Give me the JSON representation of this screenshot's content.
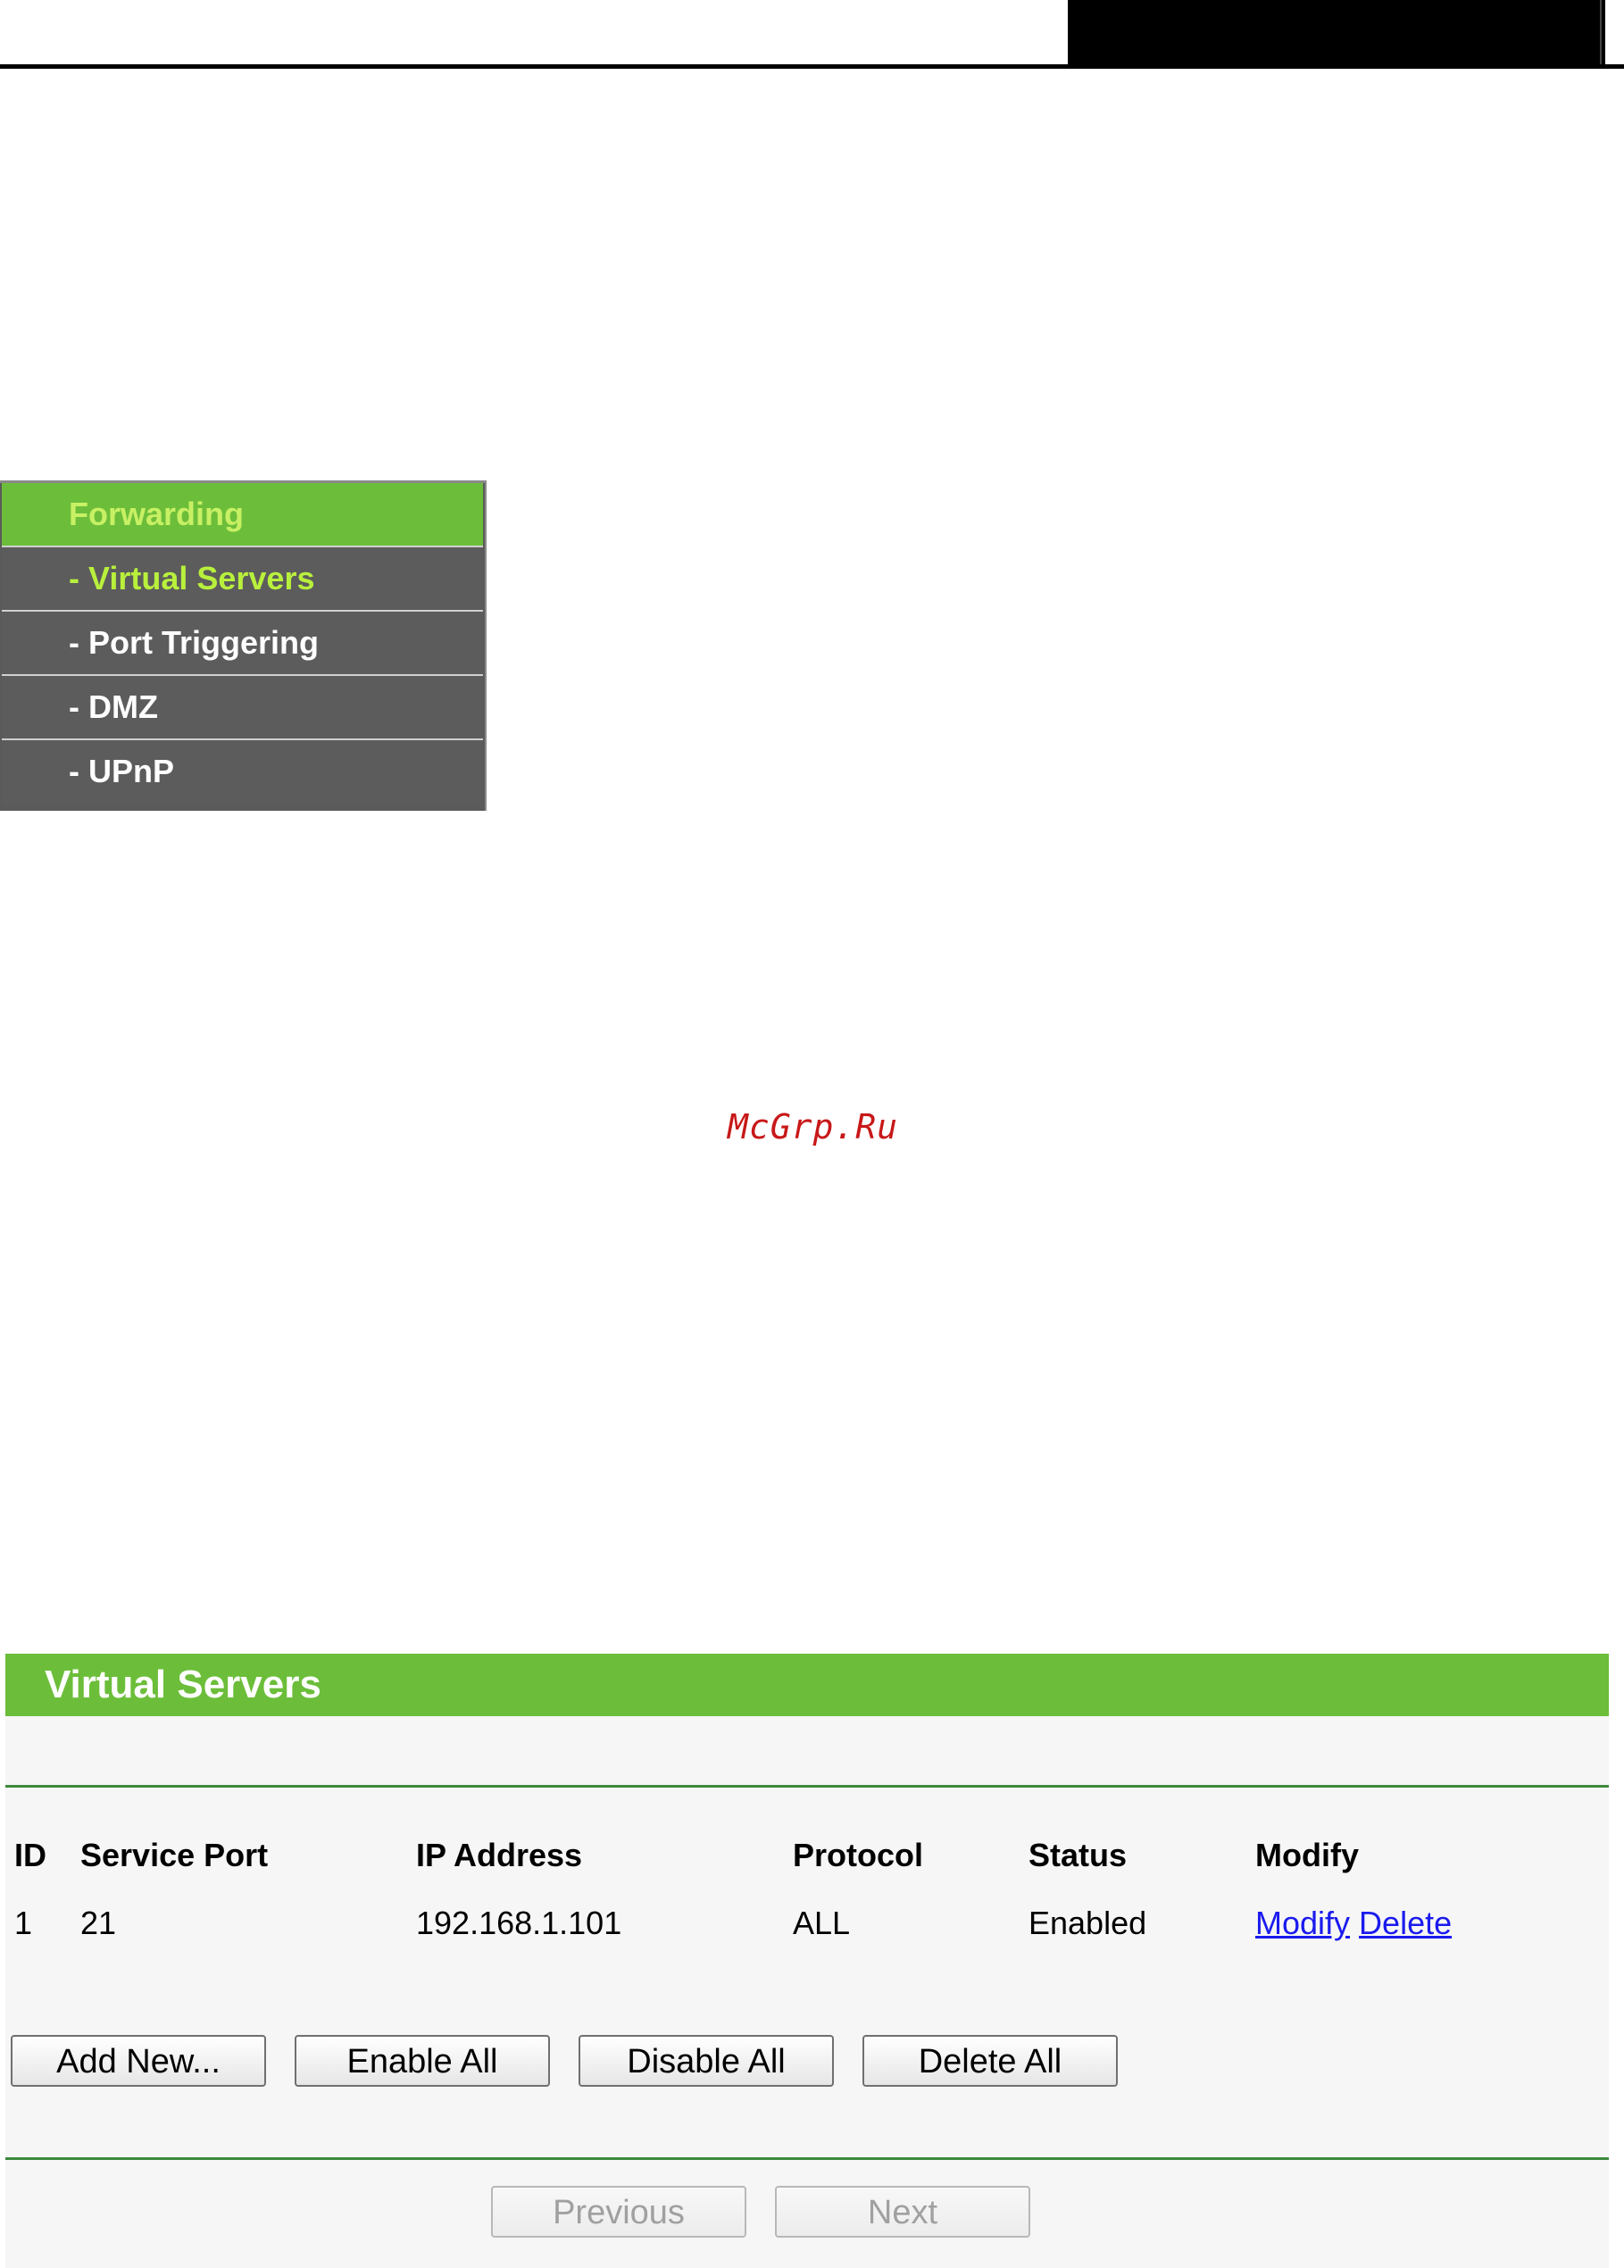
{
  "menu": {
    "header": "Forwarding",
    "items": [
      {
        "label": "- Virtual Servers",
        "active": true
      },
      {
        "label": "- Port Triggering",
        "active": false
      },
      {
        "label": "- DMZ",
        "active": false
      },
      {
        "label": "- UPnP",
        "active": false
      }
    ]
  },
  "watermark": "McGrp.Ru",
  "virtual_servers": {
    "title": "Virtual Servers",
    "columns": {
      "id": "ID",
      "service_port": "Service Port",
      "ip_address": "IP Address",
      "protocol": "Protocol",
      "status": "Status",
      "modify": "Modify"
    },
    "rows": [
      {
        "id": "1",
        "service_port": "21",
        "ip_address": "192.168.1.101",
        "protocol": "ALL",
        "status": "Enabled",
        "modify_label": "Modify",
        "delete_label": "Delete"
      }
    ],
    "buttons": {
      "add_new": "Add New...",
      "enable_all": "Enable All",
      "disable_all": "Disable All",
      "delete_all": "Delete All"
    },
    "pagination": {
      "previous": "Previous",
      "next": "Next"
    }
  },
  "colors": {
    "accent_green": "#6cbe3a",
    "menu_gray": "#5a5a5a",
    "link_blue": "#1a1aee"
  }
}
